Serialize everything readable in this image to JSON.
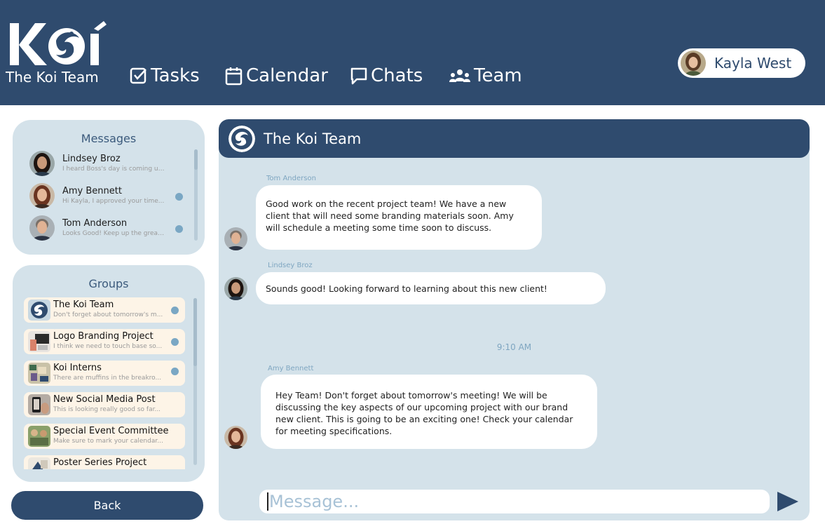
{
  "header": {
    "logo_mark": "Koí",
    "logo_text": "The Koi Team",
    "nav": [
      {
        "label": "Tasks",
        "icon": "check-square-icon"
      },
      {
        "label": "Calendar",
        "icon": "calendar-icon"
      },
      {
        "label": "Chats",
        "icon": "chat-bubble-icon"
      },
      {
        "label": "Team",
        "icon": "team-icon"
      }
    ],
    "user": {
      "name": "Kayla West"
    }
  },
  "messages": {
    "title": "Messages",
    "items": [
      {
        "name": "Lindsey Broz",
        "preview": "I heard Boss's day is coming up...",
        "unread": false
      },
      {
        "name": "Amy Bennett",
        "preview": "Hi Kayla, I approved your time...",
        "unread": true
      },
      {
        "name": "Tom Anderson",
        "preview": "Looks Good! Keep up the great...",
        "unread": true
      }
    ]
  },
  "groups": {
    "title": "Groups",
    "items": [
      {
        "name": "The Koi Team",
        "preview": "Don't forget about tomorrow's m...",
        "unread": true
      },
      {
        "name": "Logo Branding Project",
        "preview": "I think we need to touch base so...",
        "unread": true
      },
      {
        "name": "Koi Interns",
        "preview": "There are muffins in the breakro...",
        "unread": true
      },
      {
        "name": "New Social Media Post",
        "preview": "This is looking really good so far...",
        "unread": false
      },
      {
        "name": "Special Event Committee",
        "preview": "Make sure to mark your calendar...",
        "unread": false
      },
      {
        "name": "Poster Series Project",
        "preview": "",
        "unread": false
      }
    ]
  },
  "back_button": {
    "label": "Back"
  },
  "chat": {
    "title": "The Koi Team",
    "messages": [
      {
        "sender": "Tom Anderson",
        "lines": [
          "Good work on the recent project team! We have a new",
          "client that will need some branding materials soon. Amy",
          "will schedule a meeting some time soon to discuss."
        ]
      },
      {
        "sender": "Lindsey Broz",
        "lines": [
          "Sounds good! Looking forward to learning about this new client!"
        ]
      },
      {
        "sender": "Amy Bennett",
        "lines": [
          "Hey Team! Don't forget about tomorrow's meeting! We will be",
          "discussing the key aspects of our upcoming project with our brand",
          "new client. This is going to be an exciting one! Check your calendar",
          "for meeting specifications."
        ]
      }
    ],
    "timestamp": "9:10 AM",
    "input_placeholder": "Message..."
  },
  "colors": {
    "primary": "#2f4b6e",
    "panel": "#d4e2ea",
    "accent_dot": "#7aa7c4",
    "group_item_bg": "#fdf4e7"
  }
}
